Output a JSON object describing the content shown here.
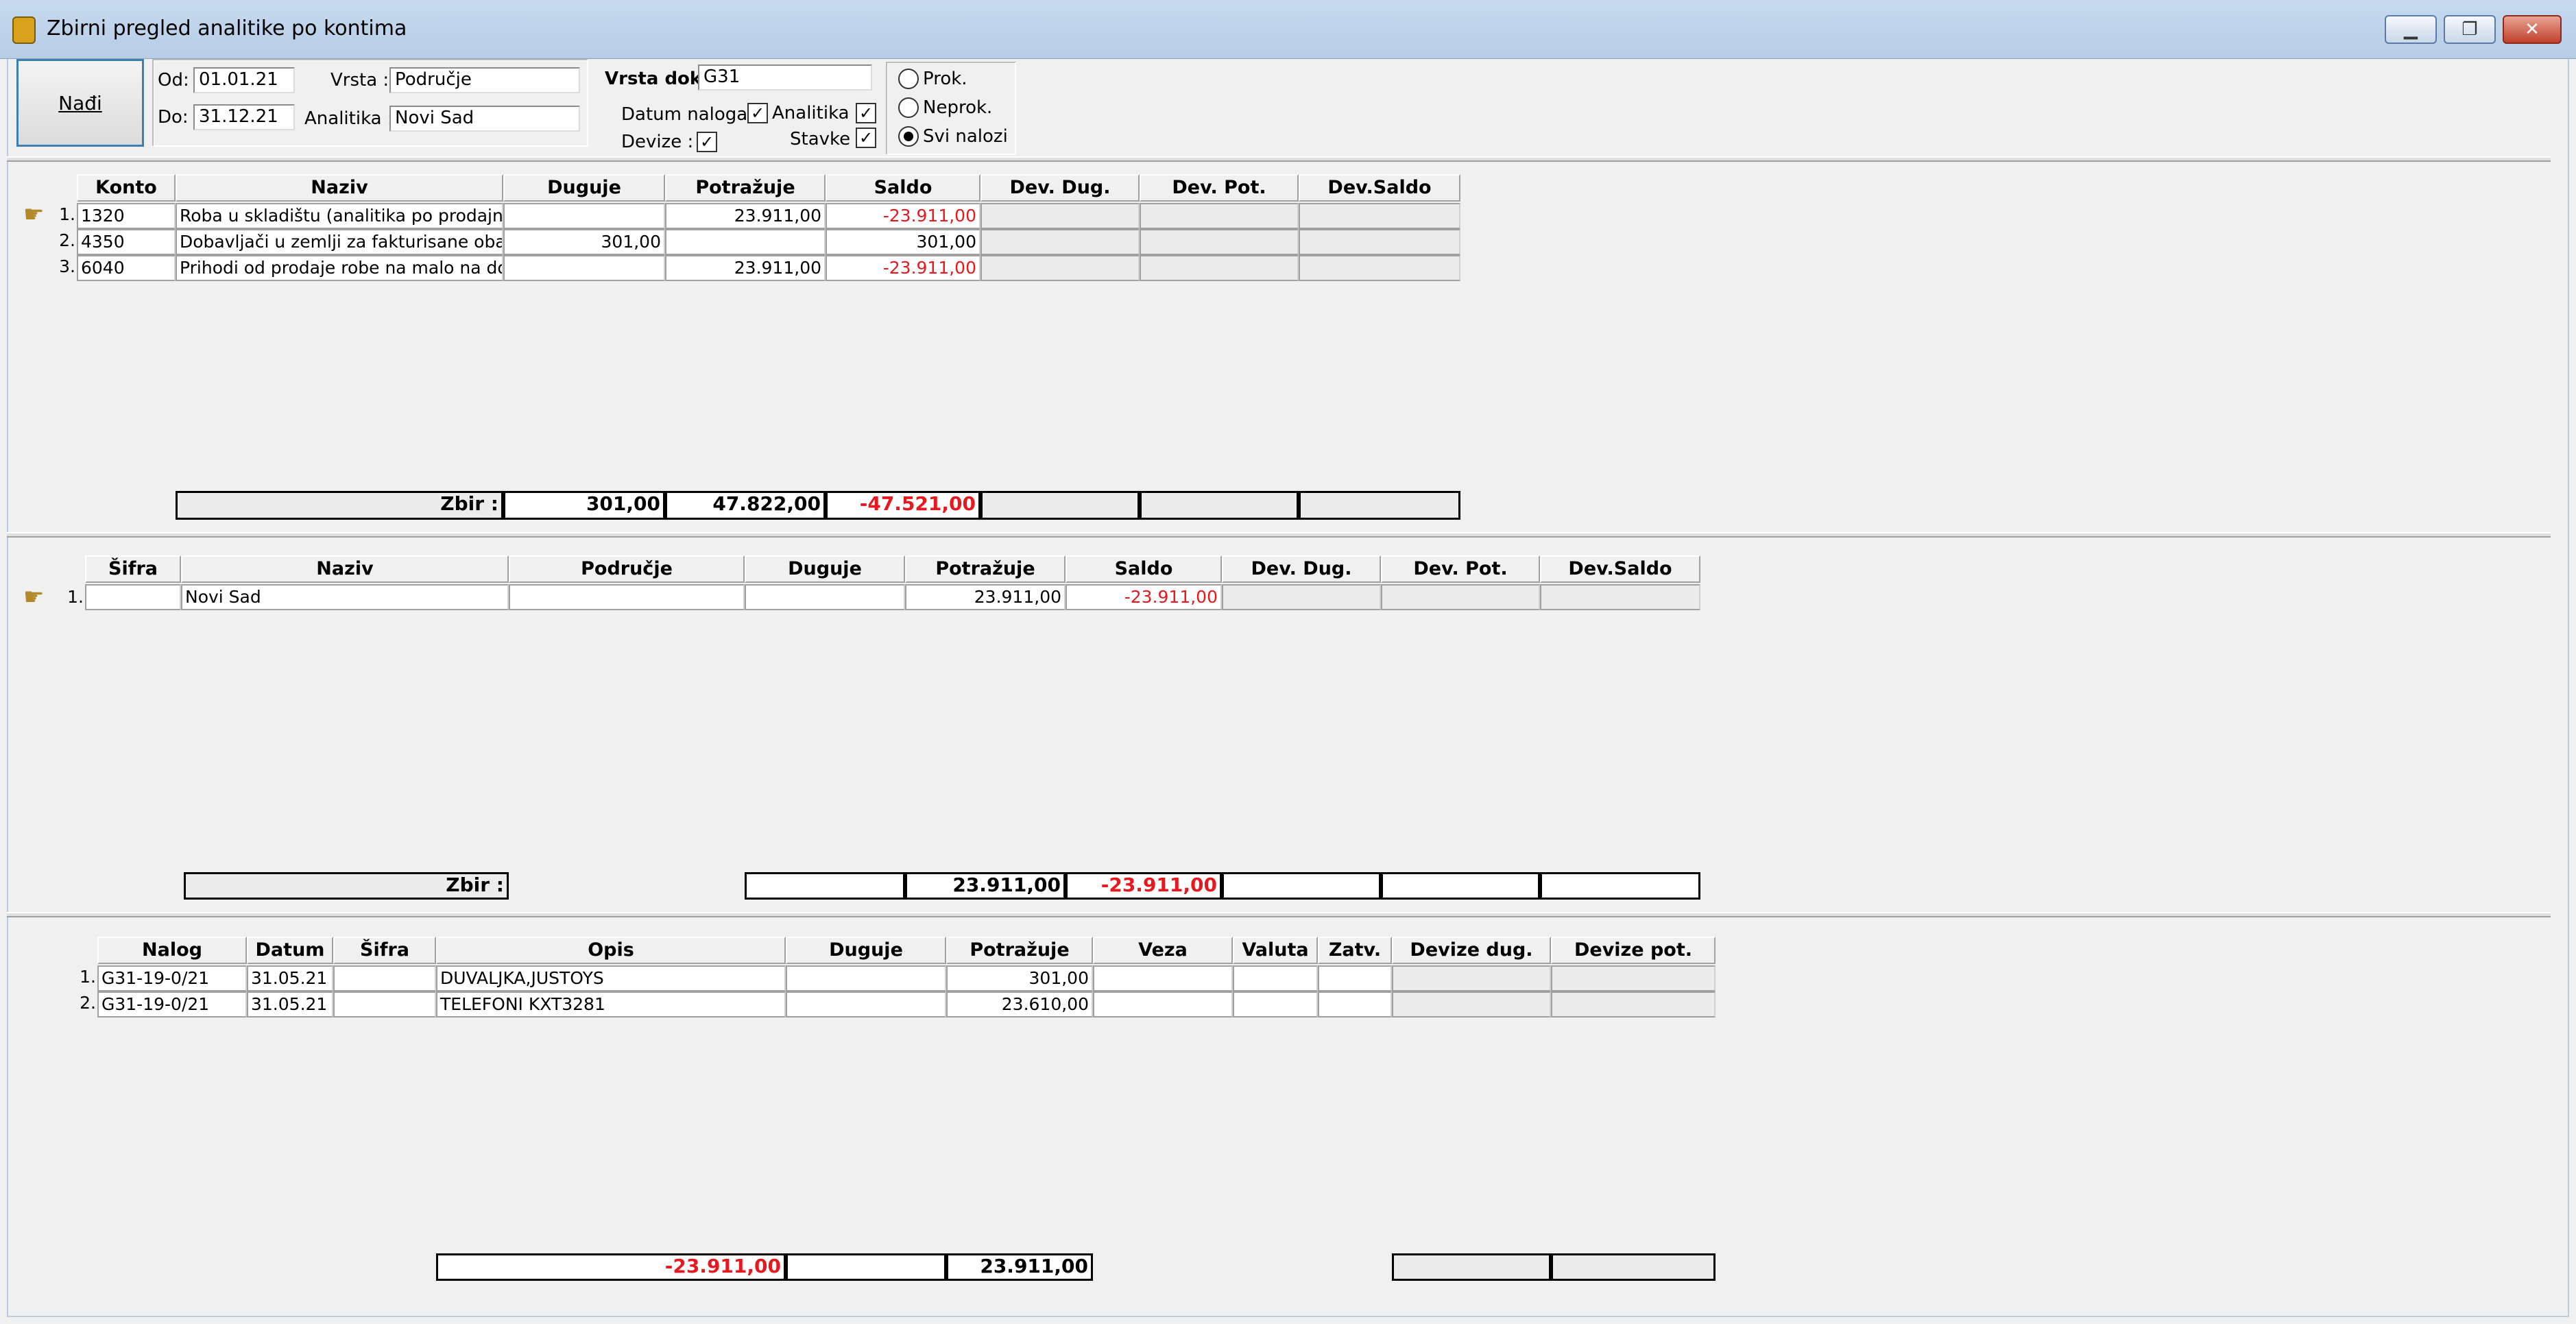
{
  "window": {
    "title": "Zbirni pregled analitike po kontima",
    "minimize": "▁",
    "restore": "❐",
    "close": "✕"
  },
  "filters": {
    "find_button": "Nađi",
    "od_label": "Od:",
    "od_value": "01.01.21",
    "do_label": "Do:",
    "do_value": "31.12.21",
    "vrsta_label": "Vrsta :",
    "vrsta_value": "Područje",
    "analitika_label": "Analitika :",
    "analitika_value": "Novi Sad",
    "vrsta_dok_label": "Vrsta dok:",
    "vrsta_dok_value": "G31",
    "datum_naloga_label": "Datum naloga:",
    "analitika_chk_label": "Analitika",
    "devize_label": "Devize :",
    "stavke_label": "Stavke",
    "check_mark": "✓",
    "radio_prok": "Prok.",
    "radio_neprok": "Neprok.",
    "radio_svi": "Svi nalozi"
  },
  "konta": {
    "headers": [
      "Konto",
      "Naziv",
      "Duguje",
      "Potražuje",
      "Saldo",
      "Dev. Dug.",
      "Dev. Pot.",
      "Dev.Saldo"
    ],
    "rows": [
      {
        "num": "1.",
        "konto": "1320",
        "naziv": "Roba u skladištu (analitika po prodajnim",
        "duguje": "",
        "potrazuje": "23.911,00",
        "saldo": "-23.911,00"
      },
      {
        "num": "2.",
        "konto": "4350",
        "naziv": "Dobavljači u zemlji za fakturisane obave",
        "duguje": "301,00",
        "potrazuje": "",
        "saldo": "301,00"
      },
      {
        "num": "3.",
        "konto": "6040",
        "naziv": "Prihodi od prodaje robe na malo na dom",
        "duguje": "",
        "potrazuje": "23.911,00",
        "saldo": "-23.911,00"
      }
    ],
    "zbir_label": "Zbir :",
    "zbir_duguje": "301,00",
    "zbir_potrazuje": "47.822,00",
    "zbir_saldo": "-47.521,00"
  },
  "analitika": {
    "headers": [
      "Šifra",
      "Naziv",
      "Područje",
      "Duguje",
      "Potražuje",
      "Saldo",
      "Dev. Dug.",
      "Dev. Pot.",
      "Dev.Saldo"
    ],
    "rows": [
      {
        "num": "1.",
        "sifra": "",
        "naziv": "Novi Sad",
        "podrucje": "",
        "duguje": "",
        "potrazuje": "23.911,00",
        "saldo": "-23.911,00"
      }
    ],
    "zbir_label": "Zbir :",
    "zbir_potrazuje": "23.911,00",
    "zbir_saldo": "-23.911,00"
  },
  "stavke": {
    "headers": [
      "Nalog",
      "Datum",
      "Šifra",
      "Opis",
      "Duguje",
      "Potražuje",
      "Veza",
      "Valuta",
      "Zatv.",
      "Devize dug.",
      "Devize pot."
    ],
    "rows": [
      {
        "num": "1.",
        "nalog": "G31-19-0/21",
        "datum": "31.05.21",
        "sifra": "",
        "opis": "DUVALJKA,JUSTOYS",
        "duguje": "",
        "potrazuje": "301,00"
      },
      {
        "num": "2.",
        "nalog": "G31-19-0/21",
        "datum": "31.05.21",
        "sifra": "",
        "opis": "TELEFONI KXT3281",
        "duguje": "",
        "potrazuje": "23.610,00"
      }
    ],
    "total_saldo": "-23.911,00",
    "total_potrazuje": "23.911,00"
  },
  "colors": {
    "negative": "#e8191e",
    "accent": "#3c7fb1"
  }
}
